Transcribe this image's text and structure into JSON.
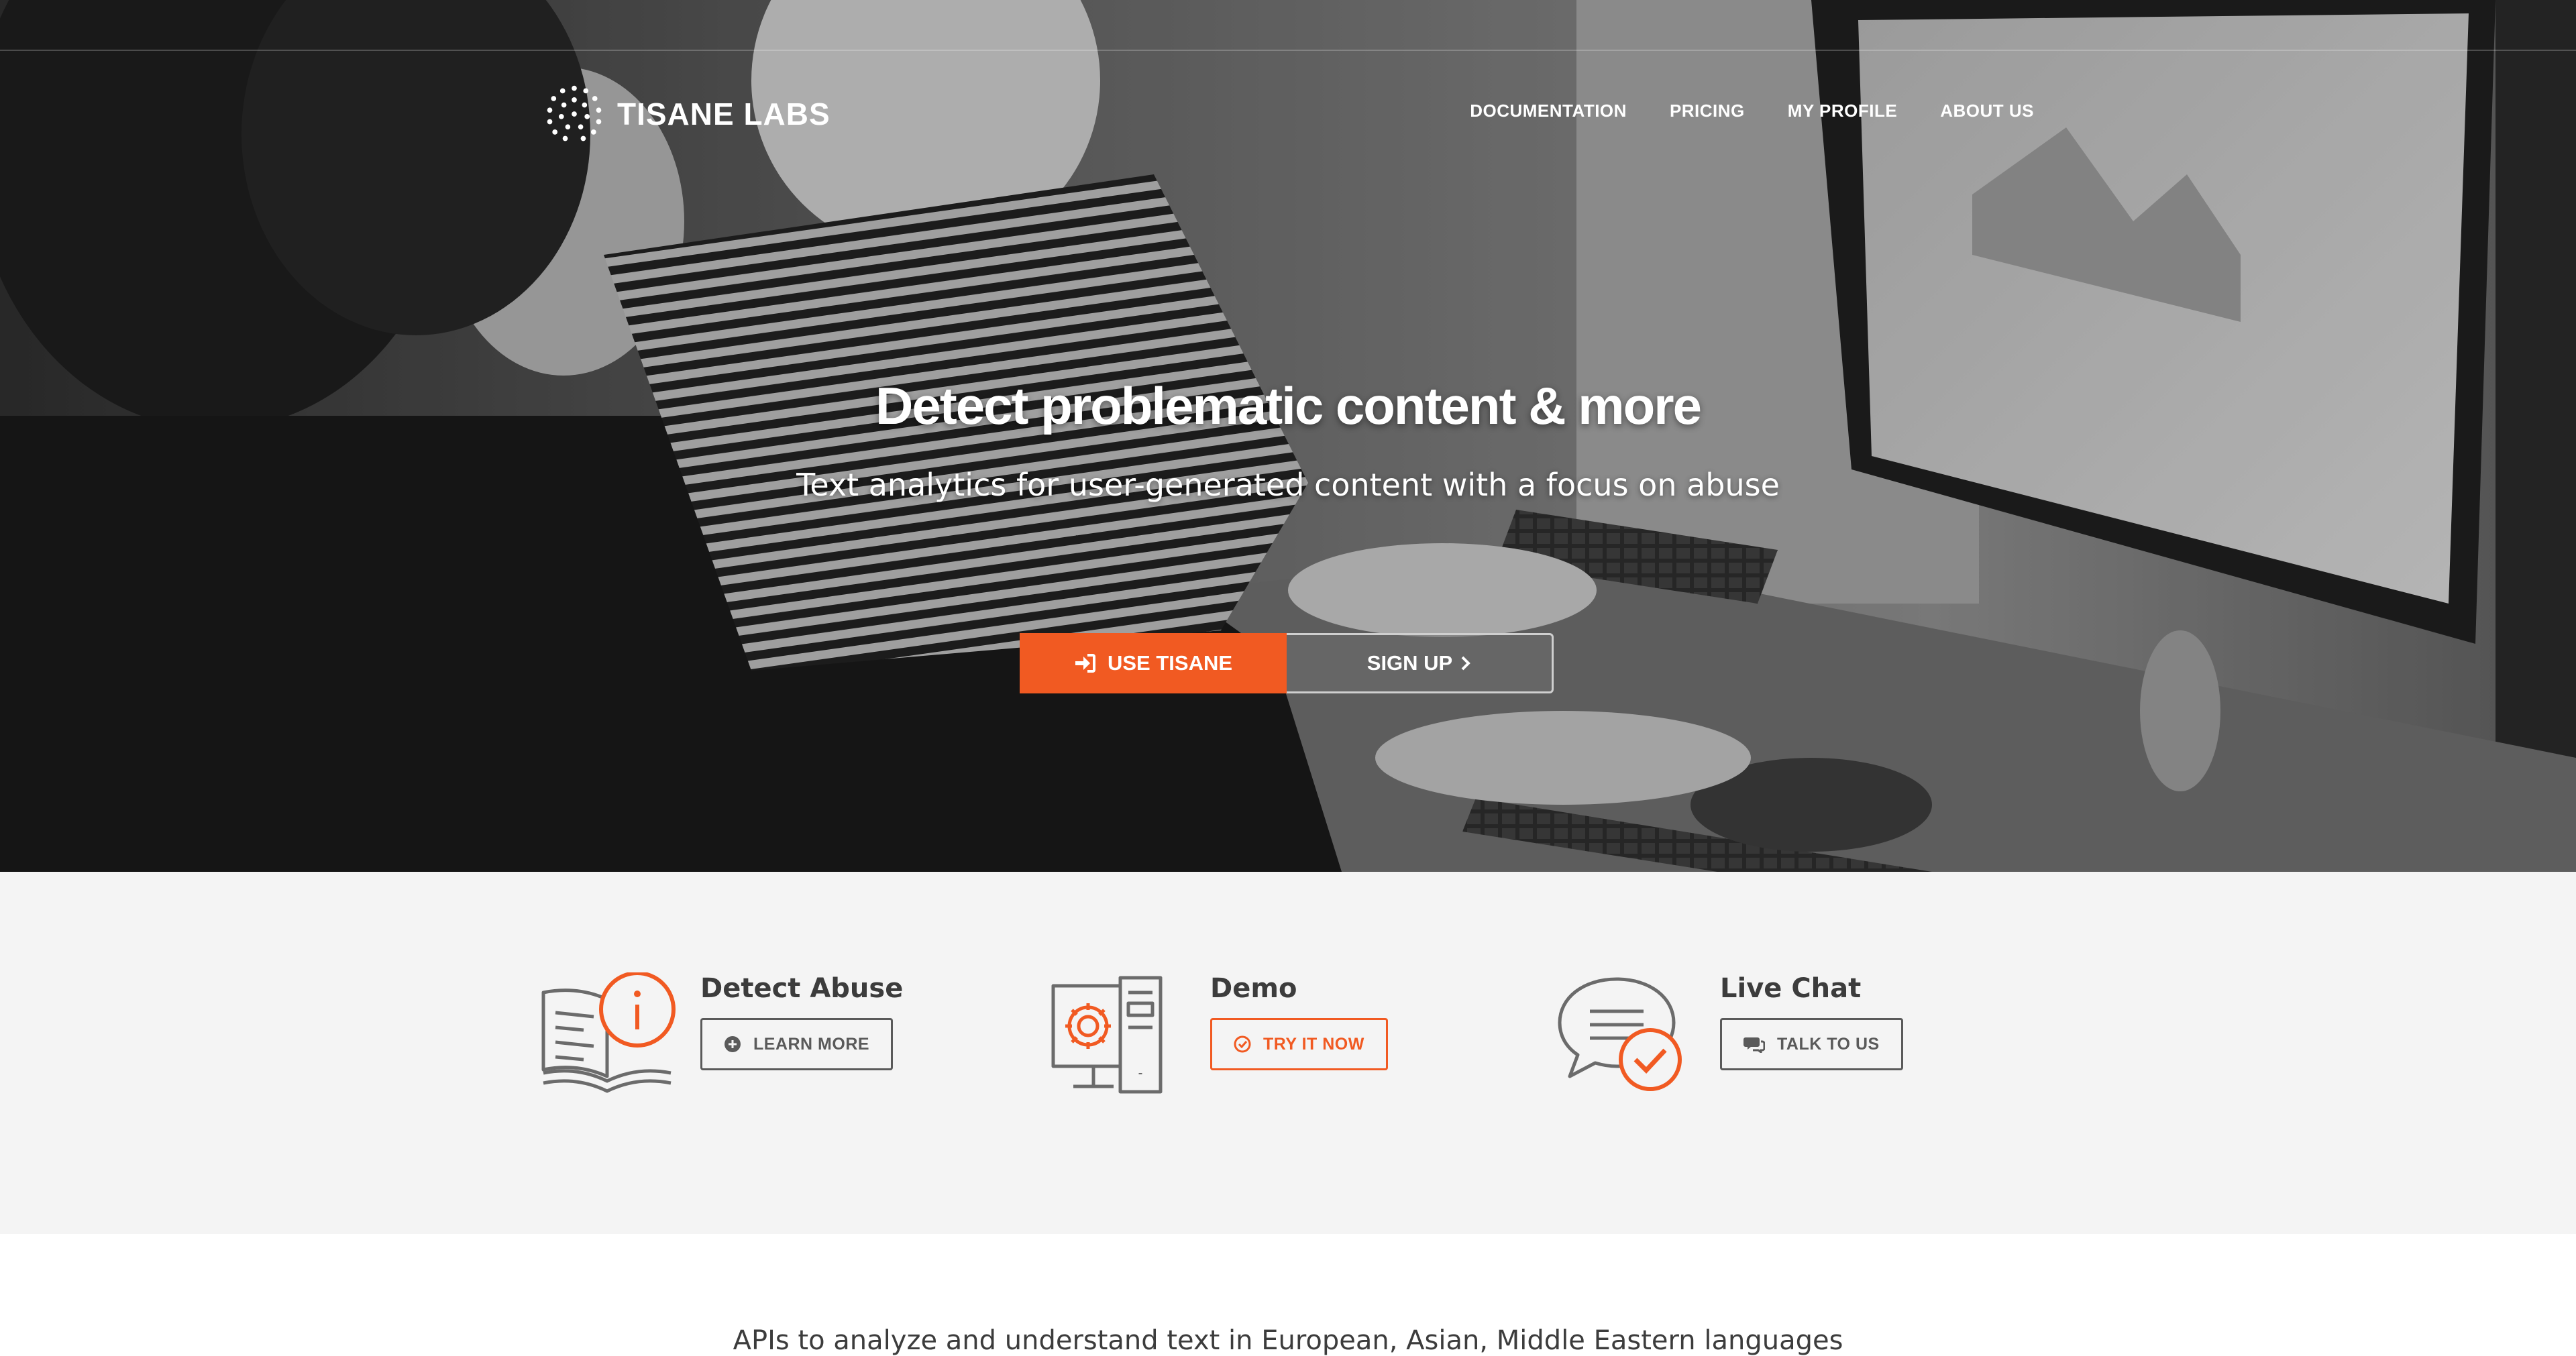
{
  "brand": {
    "name": "TISANE LABS",
    "accent": "#f15a22",
    "text_dark": "#3c3c3c"
  },
  "nav": {
    "items": [
      {
        "label": "DOCUMENTATION"
      },
      {
        "label": "PRICING"
      },
      {
        "label": "MY PROFILE"
      },
      {
        "label": "ABOUT US"
      }
    ]
  },
  "hero": {
    "title": "Detect problematic content & more",
    "subtitle": "Text analytics for user-generated content with a focus on abuse",
    "primary_button": {
      "label": "USE TISANE",
      "icon": "sign-in-icon"
    },
    "secondary_button": {
      "label": "SIGN UP",
      "icon": "chevron-right-icon"
    }
  },
  "features": [
    {
      "title": "Detect Abuse",
      "icon": "book-info-icon",
      "button": {
        "label": "LEARN MORE",
        "icon": "plus-circle-icon"
      }
    },
    {
      "title": "Demo",
      "icon": "computer-gear-icon",
      "button": {
        "label": "TRY IT NOW",
        "icon": "check-circle-icon"
      }
    },
    {
      "title": "Live Chat",
      "icon": "chat-check-icon",
      "button": {
        "label": "TALK TO US",
        "icon": "comments-icon"
      }
    }
  ],
  "intro": {
    "text": "APIs to analyze and understand text in European, Asian, Middle Eastern languages"
  }
}
